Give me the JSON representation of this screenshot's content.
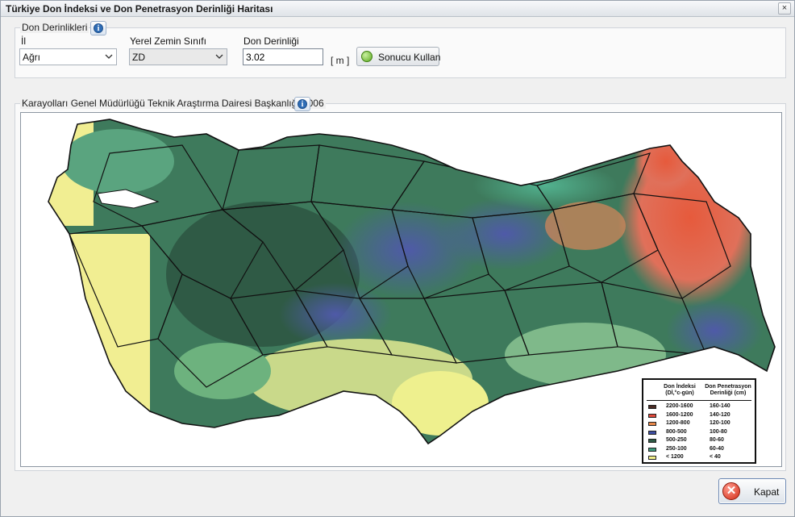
{
  "window": {
    "title": "Türkiye Don İndeksi ve Don Penetrasyon Derinliği Haritası",
    "close_glyph": "×"
  },
  "depth_group": {
    "legend": "Don Derinlikleri",
    "info_icon": "info-icon",
    "province_label": "İl",
    "province_value": "Ağrı",
    "soil_label": "Yerel Zemin Sınıfı",
    "soil_value": "ZD",
    "depth_label": "Don Derinliği",
    "depth_value": "3.02",
    "unit": "[ m ]",
    "apply_label": "Sonucu Kullan"
  },
  "map_group": {
    "legend": "Karayolları Genel Müdürlüğü Teknik Araştırma Dairesi Başkanlığı 2006",
    "info_icon": "info-icon"
  },
  "map_legend": {
    "header_index": "Don İndeksi (Dİ,°c-gün)",
    "header_depth": "Don Penetrasyon Derinliği (cm)",
    "rows": [
      {
        "index": "2200-1600",
        "depth": "160-140",
        "color": "#4a2b24"
      },
      {
        "index": "1600-1200",
        "depth": "140-120",
        "color": "#e0493b"
      },
      {
        "index": "1200-800",
        "depth": "120-100",
        "color": "#e8884a"
      },
      {
        "index": "800-500",
        "depth": "100-80",
        "color": "#3f4fa3"
      },
      {
        "index": "500-250",
        "depth": "80-60",
        "color": "#2e5a45"
      },
      {
        "index": "250-100",
        "depth": "60-40",
        "color": "#3d9a7c"
      },
      {
        "index": "< 1200",
        "depth": "< 40",
        "color": "#f3f08a"
      }
    ]
  },
  "footer": {
    "close_label": "Kapat"
  }
}
